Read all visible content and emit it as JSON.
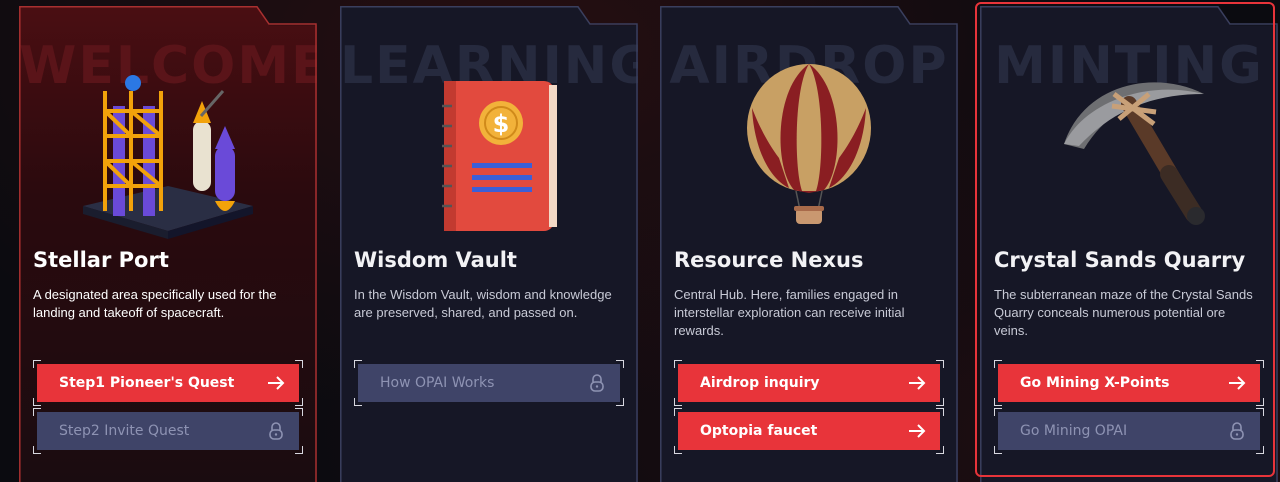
{
  "cards": [
    {
      "watermark": "WELCOME",
      "title": "Stellar Port",
      "description": "A designated area specifically used for the landing and takeoff of spacecraft.",
      "buttons": [
        {
          "label": "Step1 Pioneer's Quest",
          "icon": "arrow-right-icon",
          "style": "red"
        },
        {
          "label": "Step2 Invite Quest",
          "icon": "lock-icon",
          "style": "gray"
        }
      ]
    },
    {
      "watermark": "LEARNING",
      "title": "Wisdom Vault",
      "description": "In the Wisdom Vault, wisdom and knowledge are preserved, shared, and passed on.",
      "buttons": [
        {
          "label": "How OPAI Works",
          "icon": "lock-icon",
          "style": "gray"
        }
      ]
    },
    {
      "watermark": "AIRDROP",
      "title": "Resource Nexus",
      "description": "Central Hub. Here, families engaged in interstellar exploration can receive initial rewards.",
      "buttons": [
        {
          "label": "Airdrop inquiry",
          "icon": "arrow-right-icon",
          "style": "red"
        },
        {
          "label": "Optopia faucet",
          "icon": "arrow-right-icon",
          "style": "red"
        }
      ]
    },
    {
      "watermark": "MINTING",
      "title": "Crystal Sands Quarry",
      "description": "The subterranean maze of the Crystal Sands Quarry conceals numerous potential ore veins.",
      "buttons": [
        {
          "label": "Go Mining X-Points",
          "icon": "arrow-right-icon",
          "style": "red"
        },
        {
          "label": "Go Mining OPAI",
          "icon": "lock-icon",
          "style": "gray"
        }
      ]
    }
  ],
  "colors": {
    "accent_red": "#e8343a",
    "disabled_button": "#3f4468",
    "card_bg": "#161726",
    "highlight_border": "#e8343a"
  }
}
